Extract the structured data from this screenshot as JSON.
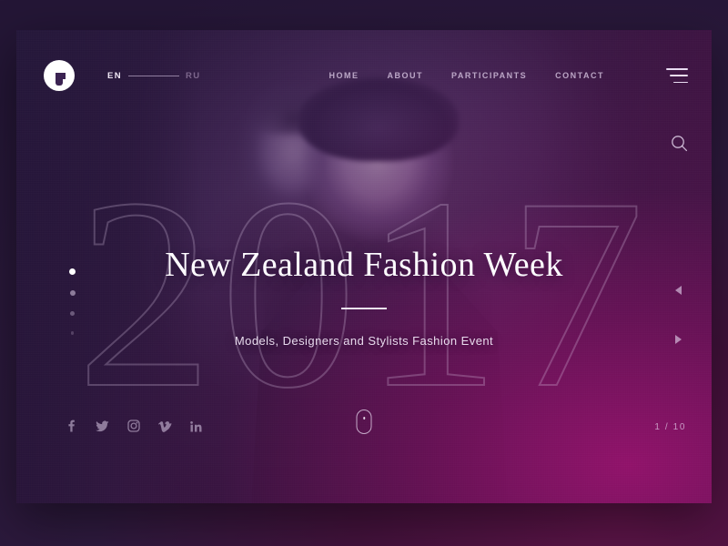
{
  "brand": {
    "logo_icon": "fashion-f-logo-icon"
  },
  "language_switch": {
    "active": "EN",
    "inactive": "RU"
  },
  "nav": {
    "items": [
      {
        "label": "HOME"
      },
      {
        "label": "ABOUT"
      },
      {
        "label": "PARTICIPANTS"
      },
      {
        "label": "CONTACT"
      }
    ],
    "menu_icon": "hamburger-menu-icon",
    "search_icon": "search-icon"
  },
  "hero": {
    "year_watermark": "2017",
    "title": "New Zealand Fashion Week",
    "subtitle": "Models, Designers and Stylists Fashion Event"
  },
  "slider": {
    "counter": "1 / 10",
    "current": 1,
    "total": 10,
    "dots": [
      {
        "active": true
      },
      {
        "active": false
      },
      {
        "active": false
      },
      {
        "active": false
      }
    ],
    "prev_icon": "triangle-left-icon",
    "next_icon": "triangle-right-icon"
  },
  "social": {
    "items": [
      {
        "name": "facebook-icon"
      },
      {
        "name": "twitter-icon"
      },
      {
        "name": "instagram-icon"
      },
      {
        "name": "vimeo-icon"
      },
      {
        "name": "linkedin-icon"
      }
    ]
  },
  "scroll": {
    "indicator_icon": "scroll-mouse-icon"
  },
  "colors": {
    "backdrop_dark": "#2a1b3d",
    "accent_magenta": "#9a126e",
    "deep_indigo": "#241636",
    "text_light": "#fdfbff"
  }
}
